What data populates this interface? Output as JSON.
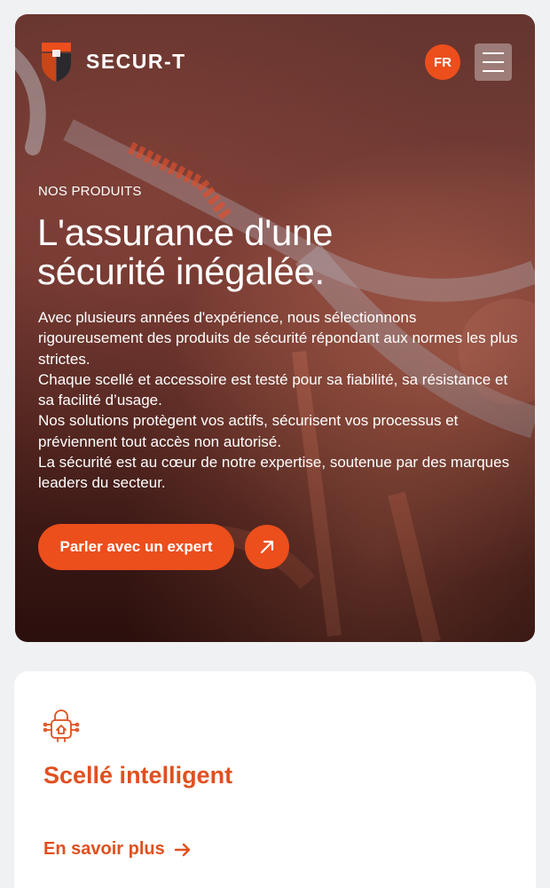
{
  "brand": {
    "name": "SECUR-T",
    "accent_color": "#ec4e1c",
    "logo_icon": "shield-logo-icon"
  },
  "header": {
    "language": "FR",
    "menu_icon": "hamburger-menu-icon"
  },
  "hero": {
    "eyebrow": "NOS PRODUITS",
    "title_line1": "L'assurance d'une",
    "title_line2": "sécurité inégalée.",
    "paragraphs": [
      "Avec plusieurs années d'expérience, nous sélectionnons rigoureusement des produits de sécurité répondant aux normes les plus strictes.",
      "Chaque scellé et accessoire est testé pour sa fiabilité, sa résistance et sa facilité d’usage.",
      "Nos solutions protègent vos actifs, sécurisent vos processus et préviennent tout accès non autorisé.",
      "La sécurité est au cœur de notre expertise, soutenue par des marques leaders du secteur."
    ],
    "cta_label": "Parler avec un expert",
    "cta_arrow_icon": "arrow-up-right-icon"
  },
  "card": {
    "icon": "smart-lock-icon",
    "title": "Scellé intelligent",
    "link_label": "En savoir plus",
    "link_icon": "arrow-right-icon"
  }
}
